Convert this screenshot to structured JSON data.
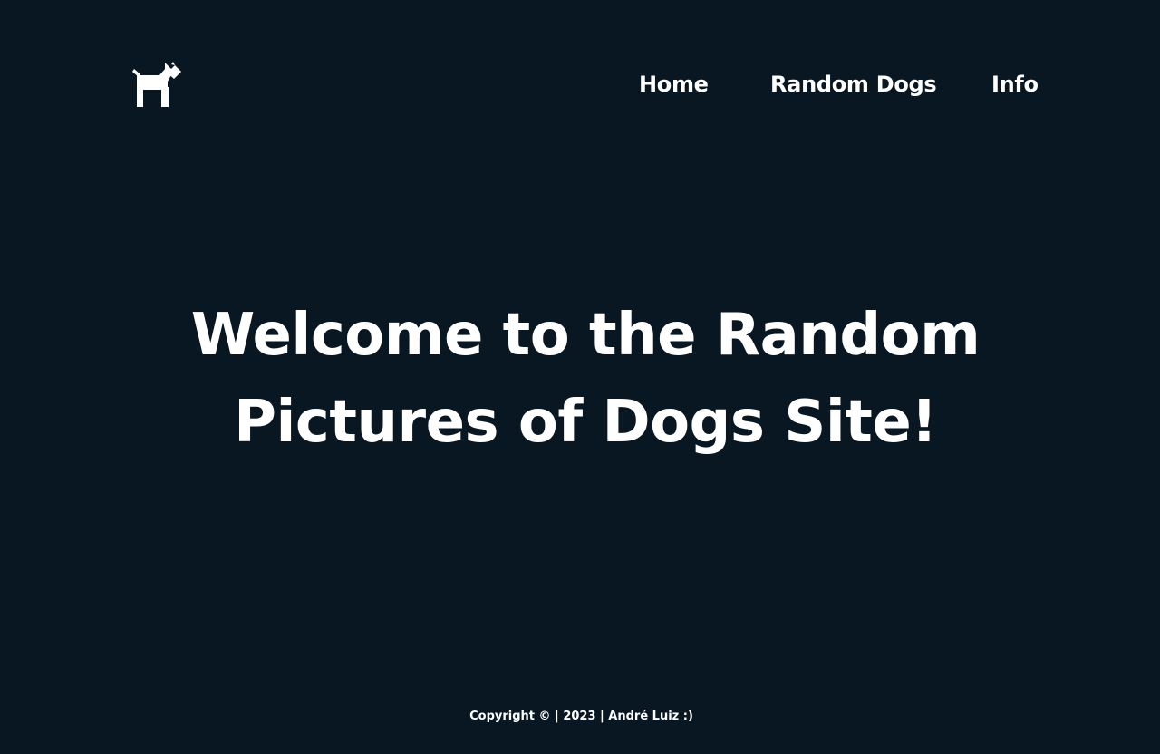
{
  "logo": {
    "icon": "dog-icon"
  },
  "nav": {
    "items": [
      {
        "label": "Home"
      },
      {
        "label": "Random Dogs"
      },
      {
        "label": "Info"
      }
    ]
  },
  "hero": {
    "title": "Welcome to the Random Pictures of Dogs Site!"
  },
  "footer": {
    "text": "Copyright © | 2023 | André Luiz :)"
  },
  "colors": {
    "background": "#091722",
    "text": "#ffffff"
  }
}
